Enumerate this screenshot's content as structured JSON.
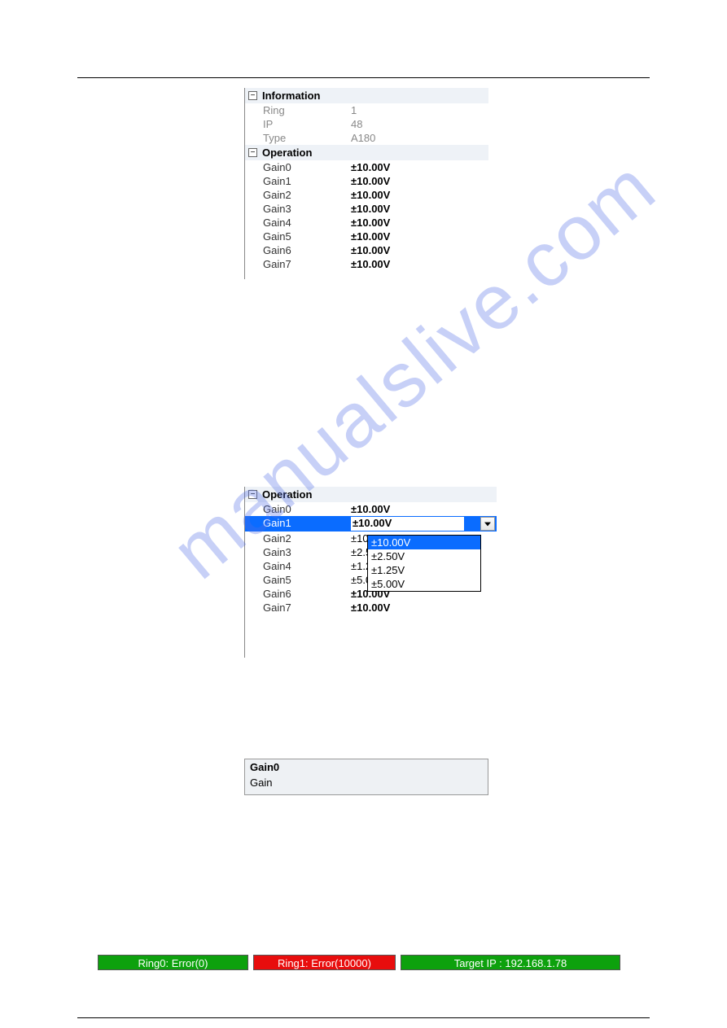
{
  "watermark": "manualslive.com",
  "panel1": {
    "information": {
      "header": "Information",
      "rows": [
        {
          "label": "Ring",
          "value": "1"
        },
        {
          "label": "IP",
          "value": "48"
        },
        {
          "label": "Type",
          "value": "A180"
        }
      ]
    },
    "operation": {
      "header": "Operation",
      "rows": [
        {
          "label": "Gain0",
          "value": "±10.00V"
        },
        {
          "label": "Gain1",
          "value": "±10.00V"
        },
        {
          "label": "Gain2",
          "value": "±10.00V"
        },
        {
          "label": "Gain3",
          "value": "±10.00V"
        },
        {
          "label": "Gain4",
          "value": "±10.00V"
        },
        {
          "label": "Gain5",
          "value": "±10.00V"
        },
        {
          "label": "Gain6",
          "value": "±10.00V"
        },
        {
          "label": "Gain7",
          "value": "±10.00V"
        }
      ]
    }
  },
  "panel2": {
    "operation": {
      "header": "Operation",
      "rows": [
        {
          "label": "Gain0",
          "value": "±10.00V"
        },
        {
          "label": "Gain1",
          "value": "±10.00V"
        },
        {
          "label": "Gain2",
          "value": "±10.00V"
        },
        {
          "label": "Gain3",
          "value": "±2.50V"
        },
        {
          "label": "Gain4",
          "value": "±1.25V"
        },
        {
          "label": "Gain5",
          "value": "±5.00V"
        },
        {
          "label": "Gain6",
          "value": "±10.00V"
        },
        {
          "label": "Gain7",
          "value": "±10.00V"
        }
      ],
      "selectedIndex": 1
    },
    "dropdown": {
      "options": [
        "±10.00V",
        "±2.50V",
        "±1.25V",
        "±5.00V"
      ],
      "highlightedIndex": 0
    }
  },
  "panel3": {
    "title": "Gain0",
    "body": "Gain"
  },
  "status": {
    "ring0": "Ring0: Error(0)",
    "ring1": "Ring1: Error(10000)",
    "target": "Target IP : 192.168.1.78"
  }
}
